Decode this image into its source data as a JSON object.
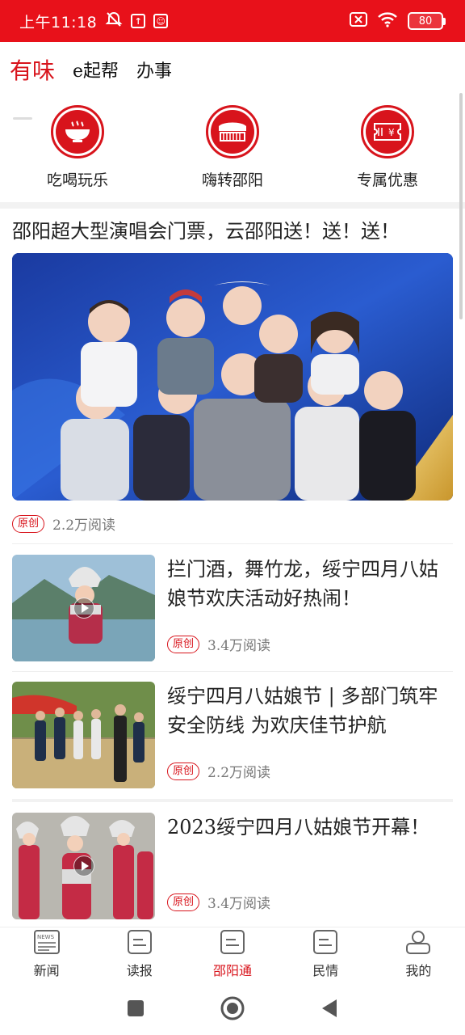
{
  "status_bar": {
    "time": "上午11:18",
    "battery": "80"
  },
  "top_tabs": [
    {
      "label": "有味",
      "active": true
    },
    {
      "label": "e起帮",
      "active": false
    },
    {
      "label": "办事",
      "active": false
    }
  ],
  "categories": [
    {
      "label": "吃喝玩乐",
      "icon": "bowl-icon"
    },
    {
      "label": "嗨转邵阳",
      "icon": "landmark-icon"
    },
    {
      "label": "专属优惠",
      "icon": "coupon-icon"
    }
  ],
  "feature": {
    "title": "邵阳超大型演唱会门票，云邵阳送！送！送！",
    "badge": "原创",
    "reads": "2.2万阅读"
  },
  "articles": [
    {
      "title": "拦门酒，舞竹龙，绥宁四月八姑娘节欢庆活动好热闹！",
      "badge": "原创",
      "reads": "3.4万阅读",
      "video": true
    },
    {
      "title": "绥宁四月八姑娘节 | 多部门筑牢安全防线 为欢庆佳节护航",
      "badge": "原创",
      "reads": "2.2万阅读",
      "video": false
    },
    {
      "title": "2023绥宁四月八姑娘节开幕！",
      "badge": "原创",
      "reads": "3.4万阅读",
      "video": true
    }
  ],
  "bottom_nav": [
    {
      "label": "新闻",
      "active": false
    },
    {
      "label": "读报",
      "active": false
    },
    {
      "label": "邵阳通",
      "active": true
    },
    {
      "label": "民情",
      "active": false
    },
    {
      "label": "我的",
      "active": false
    }
  ],
  "colors": {
    "brand_red": "#d8141c",
    "status_bar": "#e8111a"
  }
}
